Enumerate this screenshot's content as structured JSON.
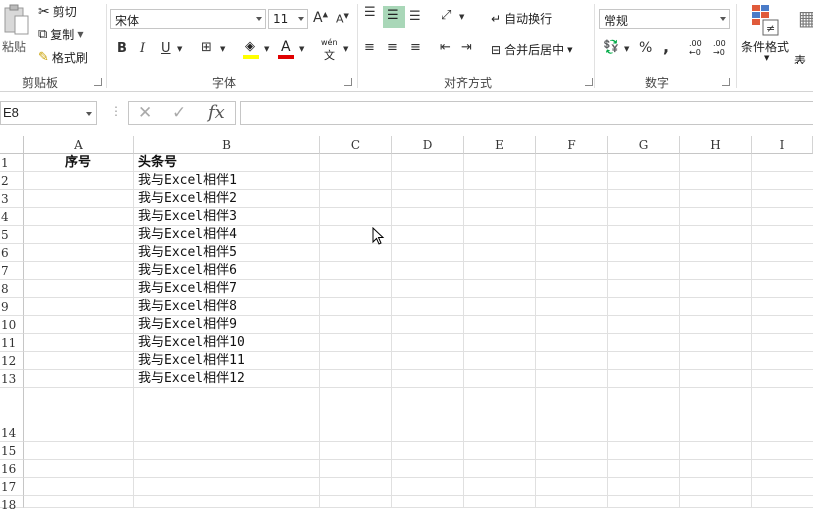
{
  "ribbon": {
    "clipboard": {
      "paste": "粘贴",
      "cut": "剪切",
      "copy": "复制",
      "format_painter": "格式刷",
      "group_label": "剪贴板"
    },
    "font": {
      "font_name": "宋体",
      "font_size": "11",
      "group_label": "字体",
      "bold": "B",
      "italic": "I",
      "underline": "U",
      "grow": "A",
      "shrink": "A",
      "font_color_letter": "A",
      "phonetic_top": "wén",
      "phonetic_bottom": "文"
    },
    "alignment": {
      "wrap_text": "自动换行",
      "merge_center": "合并后居中",
      "group_label": "对齐方式"
    },
    "number": {
      "format": "常规",
      "percent": "%",
      "comma": ",",
      "inc_decimal": ".00",
      "dec_decimal": ".00",
      "group_label": "数字"
    },
    "styles": {
      "conditional_format": "条件格式",
      "table_format": "表格"
    }
  },
  "formula_bar": {
    "name_box": "E8",
    "cancel": "✕",
    "enter": "✓",
    "fx": "fx",
    "formula": ""
  },
  "sheet": {
    "columns": [
      "A",
      "B",
      "C",
      "D",
      "E",
      "F",
      "G",
      "H",
      "I"
    ],
    "rows": [
      "1",
      "2",
      "3",
      "4",
      "5",
      "6",
      "7",
      "8",
      "9",
      "10",
      "11",
      "12",
      "13",
      "14",
      "15",
      "16",
      "17",
      "18"
    ],
    "cells": {
      "A1": "序号",
      "B1": "头条号",
      "B_values": [
        "我与Excel相伴1",
        "我与Excel相伴2",
        "我与Excel相伴3",
        "我与Excel相伴4",
        "我与Excel相伴5",
        "我与Excel相伴6",
        "我与Excel相伴7",
        "我与Excel相伴8",
        "我与Excel相伴9",
        "我与Excel相伴10",
        "我与Excel相伴11",
        "我与Excel相伴12"
      ]
    }
  },
  "colors": {
    "accent_green": "#a9d7b8",
    "font_color_bar": "#e00000",
    "highlight_bar": "#ffff00"
  }
}
